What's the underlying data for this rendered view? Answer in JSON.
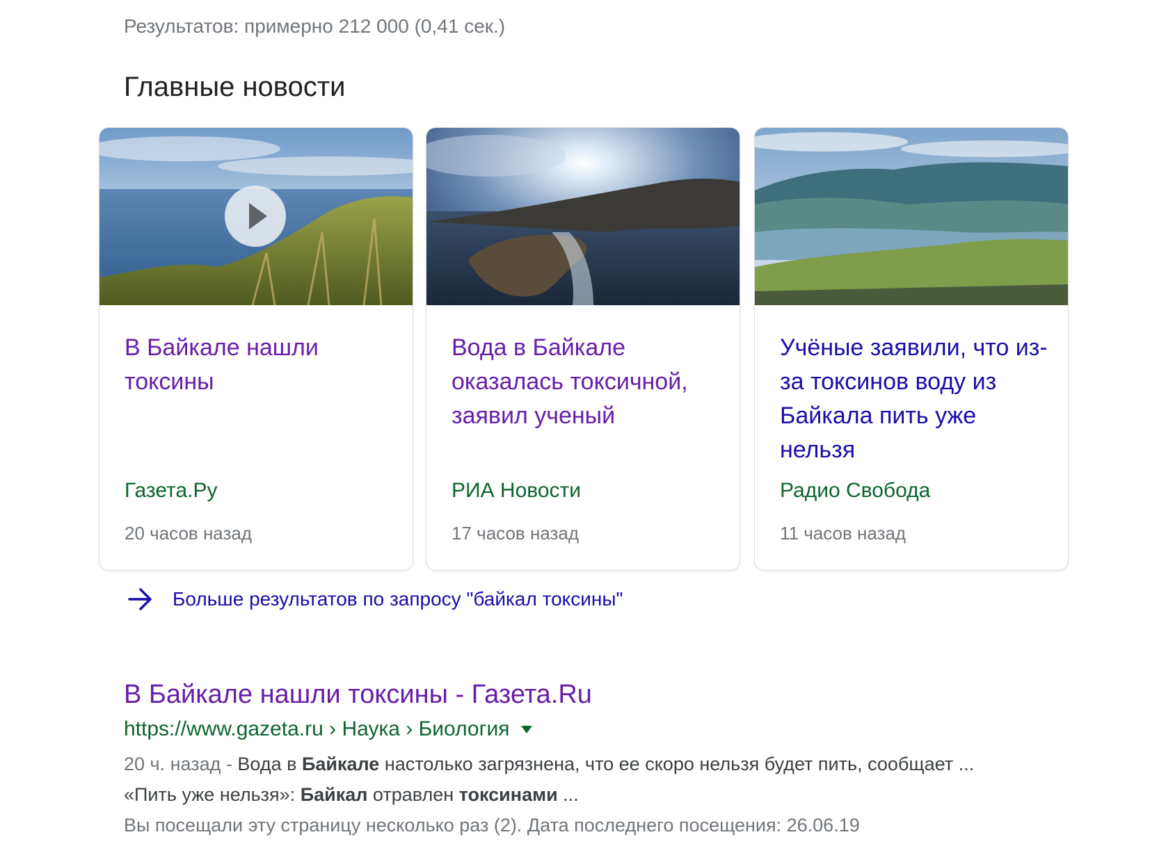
{
  "stats": "Результатов: примерно 212 000 (0,41 сек.)",
  "top_stories": {
    "heading": "Главные новости",
    "cards": [
      {
        "title": "В Байкале нашли токсины",
        "source": "Газета.Ру",
        "time": "20 часов назад",
        "has_video": true
      },
      {
        "title": "Вода в Байкале оказалась токсичной, заявил ученый",
        "source": "РИА Новости",
        "time": "17 часов назад"
      },
      {
        "title": "Учёные заявили, что из-за токсинов воду из Байкала пить уже нельзя",
        "source": "Радио Свобода",
        "time": "11 часов назад"
      }
    ],
    "more_label": "Больше результатов по запросу \"байкал токсины\""
  },
  "result": {
    "title": "В Байкале нашли токсины - Газета.Ru",
    "url": "https://www.gazeta.ru › Наука › Биология",
    "snippet": {
      "date": "20 ч. назад",
      "sep": " - ",
      "l1_a": "Вода в ",
      "l1_b": "Байкале",
      "l1_c": " настолько загрязнена, что ее скоро нельзя будет пить, сообщает ...",
      "l2_a": "«Пить уже нельзя»: ",
      "l2_b": "Байкал",
      "l2_c": " отравлен ",
      "l2_d": "токсинами",
      "l2_e": " ..."
    },
    "visited": "Вы посещали эту страницу несколько раз (2). Дата последнего посещения: 26.06.19"
  },
  "colors": {
    "visited_link": "#681da8",
    "link": "#1a0dab",
    "source_green": "#0d652d",
    "meta_gray": "#70757a"
  },
  "icons": {
    "play": "play-icon",
    "more": "arrow-right-icon",
    "url_menu": "caret-down-icon"
  }
}
